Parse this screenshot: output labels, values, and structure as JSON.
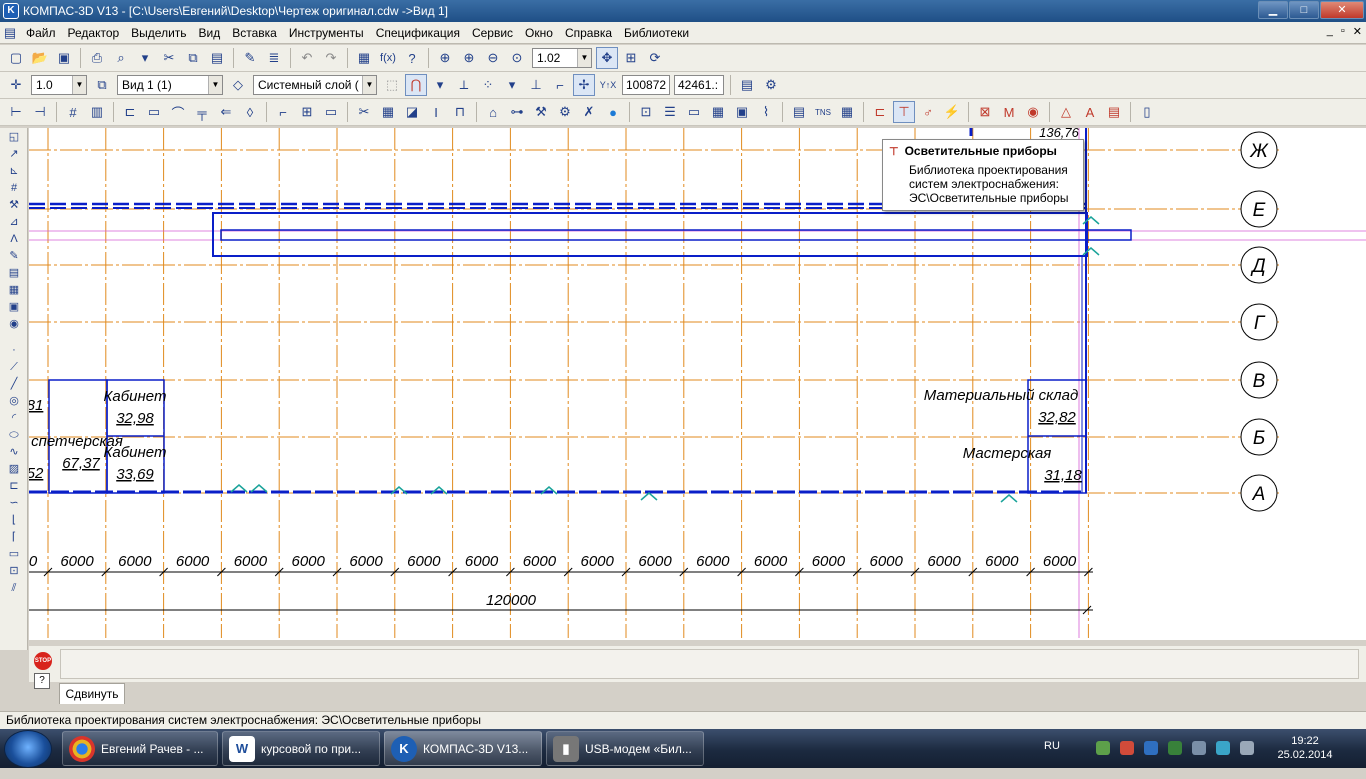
{
  "window": {
    "title": "КОМПАС-3D V13 - [C:\\Users\\Евгений\\Desktop\\Чертеж оригинал.cdw ->Вид 1]",
    "logo_letter": "K",
    "minimize": "▁",
    "maximize": "□",
    "close": "✕"
  },
  "menu": {
    "items": [
      "Файл",
      "Редактор",
      "Выделить",
      "Вид",
      "Вставка",
      "Инструменты",
      "Спецификация",
      "Сервис",
      "Окно",
      "Справка",
      "Библиотеки"
    ],
    "mdi_buttons": [
      "_",
      "▫",
      "✕"
    ]
  },
  "toolbar1": {
    "zoom_value": "1.02"
  },
  "toolbar2": {
    "scale_value": "1.0",
    "view_value": "Вид 1 (1)",
    "layer_value": "Системный слой (",
    "coord_x": "100872",
    "coord_y": "42461.:"
  },
  "tooltip": {
    "title": "Осветительные приборы",
    "lines": [
      "Библиотека проектирования",
      "систем электроснабжения:",
      "ЭС\\Осветительные приборы"
    ]
  },
  "drawing": {
    "row_labels": [
      "Ж",
      "Е",
      "Д",
      "Г",
      "В",
      "Б",
      "А"
    ],
    "dimension_labels": [
      "0",
      "6000",
      "6000",
      "6000",
      "6000",
      "6000",
      "6000",
      "6000",
      "6000",
      "6000",
      "6000",
      "6000",
      "6000",
      "6000",
      "6000",
      "6000",
      "6000",
      "6000",
      "6000"
    ],
    "total_dimension": "120000",
    "top_dimension": "136,76",
    "rooms": [
      {
        "name": "Кабинет",
        "area": "32,98"
      },
      {
        "name": "Кабинет",
        "area": "33,69"
      },
      {
        "name": "спетчерская",
        "area": "67,37"
      },
      {
        "name": "",
        "area": "81"
      },
      {
        "name": "",
        "area": "52"
      },
      {
        "name": "Материальный склад",
        "area": "32,82"
      },
      {
        "name": "Мастерская",
        "area": "31,18"
      }
    ]
  },
  "command": {
    "stop_label": "STOP",
    "help_label": "?",
    "tab_label": "Сдвинуть"
  },
  "status_text": "Библиотека проектирования систем электроснабжения: ЭС\\Осветительные приборы",
  "taskbar": {
    "tasks": [
      {
        "label": "Евгений Рачев - ...",
        "icon": "chrome-icon"
      },
      {
        "label": "курсовой по при...",
        "icon": "word-icon"
      },
      {
        "label": "КОМПАС-3D V13...",
        "icon": "kompas-icon"
      },
      {
        "label": "USB-модем «Бил...",
        "icon": "modem-icon"
      }
    ],
    "language": "RU",
    "time": "19:22",
    "date": "25.02.2014"
  },
  "colors": {
    "grid_orange": "#e08a1e",
    "wall_blue": "#0a1fc8",
    "accent_teal": "#1aa39a",
    "magenta_line": "#d45cd4"
  }
}
